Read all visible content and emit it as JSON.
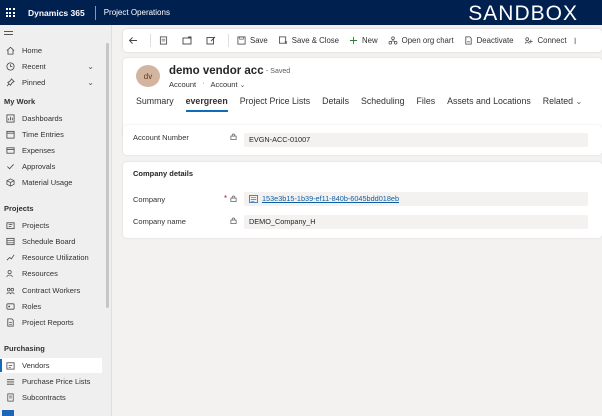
{
  "topbar": {
    "app_title": "Dynamics 365",
    "module_name": "Project Operations",
    "environment": "SANDBOX"
  },
  "sidebar": {
    "top_items": [
      {
        "label": "Home",
        "icon": "home-icon"
      },
      {
        "label": "Recent",
        "icon": "clock-icon"
      },
      {
        "label": "Pinned",
        "icon": "pin-icon"
      }
    ],
    "sections": [
      {
        "title": "My Work",
        "items": [
          {
            "label": "Dashboards",
            "icon": "dashboard-icon"
          },
          {
            "label": "Time Entries",
            "icon": "calendar-icon"
          },
          {
            "label": "Expenses",
            "icon": "receipt-icon"
          },
          {
            "label": "Approvals",
            "icon": "approval-icon"
          },
          {
            "label": "Material Usage",
            "icon": "package-icon"
          }
        ]
      },
      {
        "title": "Projects",
        "items": [
          {
            "label": "Projects",
            "icon": "projects-icon"
          },
          {
            "label": "Schedule Board",
            "icon": "board-icon"
          },
          {
            "label": "Resource Utilization",
            "icon": "utilization-icon"
          },
          {
            "label": "Resources",
            "icon": "people-icon"
          },
          {
            "label": "Contract Workers",
            "icon": "worker-icon"
          },
          {
            "label": "Roles",
            "icon": "roles-icon"
          },
          {
            "label": "Project Reports",
            "icon": "report-icon"
          }
        ]
      },
      {
        "title": "Purchasing",
        "items": [
          {
            "label": "Vendors",
            "icon": "vendor-icon",
            "active": true
          },
          {
            "label": "Purchase Price Lists",
            "icon": "price-list-icon"
          },
          {
            "label": "Subcontracts",
            "icon": "contract-icon"
          }
        ]
      }
    ]
  },
  "commandbar": {
    "back": "back-arrow-icon",
    "save": "Save",
    "save_close": "Save & Close",
    "new": "New",
    "org_chart": "Open org chart",
    "deactivate": "Deactivate",
    "connect": "Connect"
  },
  "record": {
    "avatar_initials": "dv",
    "name": "demo vendor acc",
    "status": "- Saved",
    "entity": "Account",
    "form": "Account",
    "tabs": [
      "Summary",
      "evergreen",
      "Project Price Lists",
      "Details",
      "Scheduling",
      "Files",
      "Assets and Locations",
      "Related"
    ]
  },
  "fields": {
    "account_number_label": "Account Number",
    "account_number_value": "EVGN-ACC-01007",
    "company_details_title": "Company details",
    "company_label": "Company",
    "company_value": "153e3b15-1b39-ef11-840b-6045bdd018eb",
    "company_name_label": "Company name",
    "company_name_value": "DEMO_Company_H"
  },
  "colors": {
    "topbar": "#002050",
    "accent": "#0f6cbd",
    "avatar_bg": "#d3b49e"
  }
}
